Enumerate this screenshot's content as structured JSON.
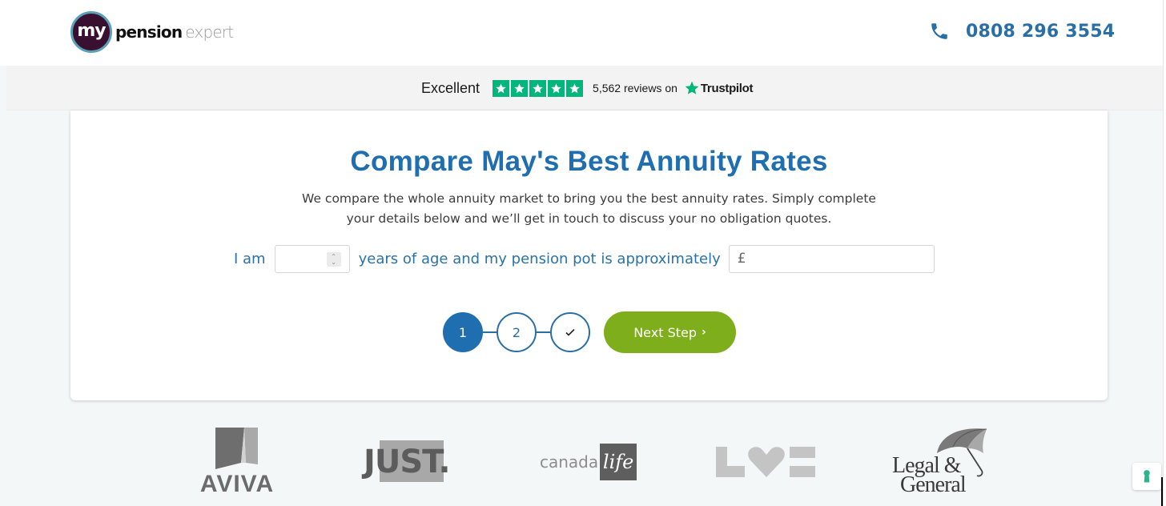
{
  "header": {
    "logo": {
      "word_my": "my",
      "word_pension": "pension",
      "word_expert": "expert",
      "colors": {
        "badge": "#3a1030",
        "ring": "#5aa0b8"
      }
    },
    "phone": {
      "icon": "phone-icon",
      "number": "0808 296 3554",
      "color": "#2a6ea6"
    }
  },
  "trustbar": {
    "rating_label": "Excellent",
    "stars": 5,
    "star_color": "#00b67a",
    "reviews_text": "5,562 reviews on",
    "brand": "Trustpilot"
  },
  "hero": {
    "title": "Compare May's Best Annuity Rates",
    "subtitle_lines": [
      "We compare the whole annuity market to bring you the best annuity rates. Simply complete",
      "your details below and we’ll get in touch to discuss your no obligation quotes."
    ],
    "form": {
      "label_prefix": "I am",
      "age_value": "",
      "label_middle": "years of age and my pension pot is approximately",
      "currency_symbol": "£",
      "pot_value": ""
    },
    "steps": [
      {
        "label": "1",
        "state": "active"
      },
      {
        "label": "2",
        "state": "pending"
      },
      {
        "label": "check-icon",
        "state": "pending"
      }
    ],
    "next_button": {
      "label": "Next Step",
      "icon": "chevron-right-icon",
      "color": "#7fae1c"
    }
  },
  "partners": [
    {
      "name": "AVIVA"
    },
    {
      "name": "JUST."
    },
    {
      "name_word": "canada",
      "name_box": "life"
    },
    {
      "name": "LV="
    },
    {
      "line1": "Legal &",
      "line2": "General"
    }
  ],
  "widgets": {
    "cookie_button": "keyhole-icon",
    "cookie_color": "#2bb58a"
  }
}
